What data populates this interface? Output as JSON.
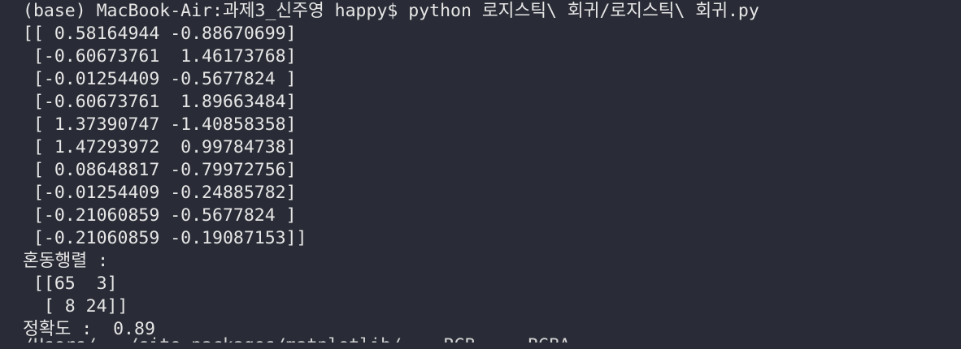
{
  "terminal": {
    "prompt_line": "(base) MacBook-Air:과제3_신주영 happy$ python 로지스틱\\ 회귀/로지스틱\\ 회귀.py",
    "matrix": [
      "[[ 0.58164944 -0.88670699]",
      " [-0.60673761  1.46173768]",
      " [-0.01254409 -0.5677824 ]",
      " [-0.60673761  1.89663484]",
      " [ 1.37390747 -1.40858358]",
      " [ 1.47293972  0.99784738]",
      " [ 0.08648817 -0.79972756]",
      " [-0.01254409 -0.24885782]",
      " [-0.21060859 -0.5677824 ]",
      " [-0.21060859 -0.19087153]]"
    ],
    "confusion_label": "혼동행렬 :",
    "confusion_rows": [
      " [[65  3]",
      "  [ 8 24]]"
    ],
    "accuracy_line": "정확도 :  0.89",
    "cut_off_line": "/Users/.../site-packages/matplotlib/... RGB ... RGBA ..."
  }
}
